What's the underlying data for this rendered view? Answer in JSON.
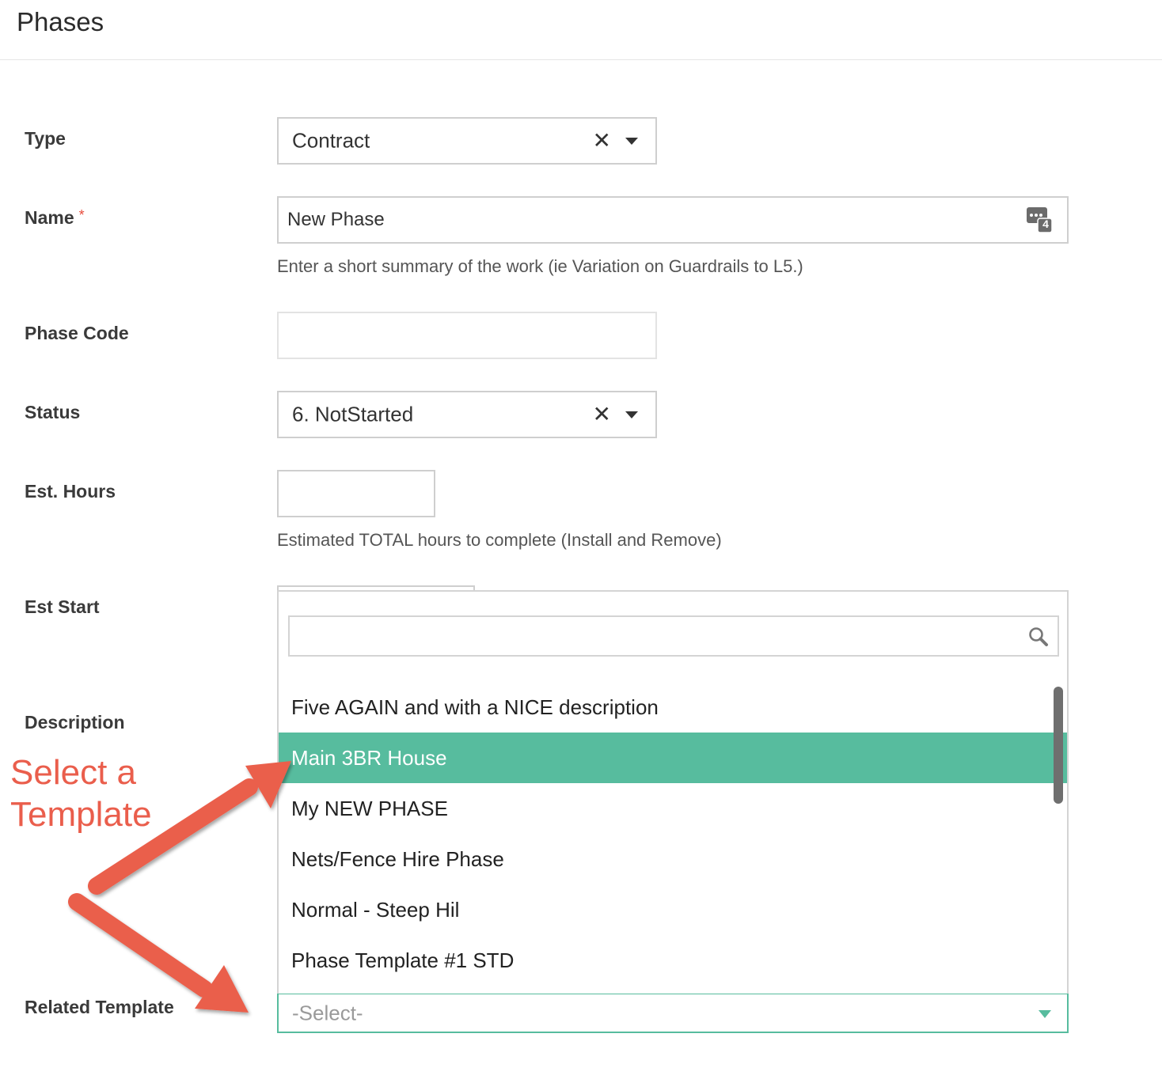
{
  "header": {
    "title": "Phases"
  },
  "form": {
    "type": {
      "label": "Type",
      "value": "Contract",
      "clear_glyph": "✕"
    },
    "name": {
      "label": "Name",
      "required_mark": "*",
      "value": "New Phase",
      "help": "Enter a short summary of the work (ie Variation on Guardrails to L5.)",
      "counter_badge": "4",
      "counter_icon": "chat-counter-icon"
    },
    "phase_code": {
      "label": "Phase Code",
      "value": ""
    },
    "status": {
      "label": "Status",
      "value": "6. NotStarted",
      "clear_glyph": "✕"
    },
    "est_hours": {
      "label": "Est. Hours",
      "value": "",
      "help": "Estimated TOTAL hours to complete (Install and Remove)"
    },
    "est_start": {
      "label": "Est Start"
    },
    "description": {
      "label": "Description"
    },
    "related_template": {
      "label": "Related Template",
      "placeholder": "-Select-"
    }
  },
  "dropdown": {
    "search_value": "",
    "search_icon": "search-icon",
    "options": [
      {
        "label": "Five AGAIN and with a NICE description",
        "highlighted": false
      },
      {
        "label": "Main 3BR House",
        "highlighted": true
      },
      {
        "label": "My NEW PHASE",
        "highlighted": false
      },
      {
        "label": "Nets/Fence Hire Phase",
        "highlighted": false
      },
      {
        "label": "Normal - Steep Hil",
        "highlighted": false
      },
      {
        "label": "Phase Template #1 STD",
        "highlighted": false
      }
    ]
  },
  "annotation": {
    "line1": "Select a",
    "line2": "Template",
    "color": "#ea5e4c"
  },
  "colors": {
    "accent": "#57bc9e",
    "required": "#e74c3c"
  }
}
